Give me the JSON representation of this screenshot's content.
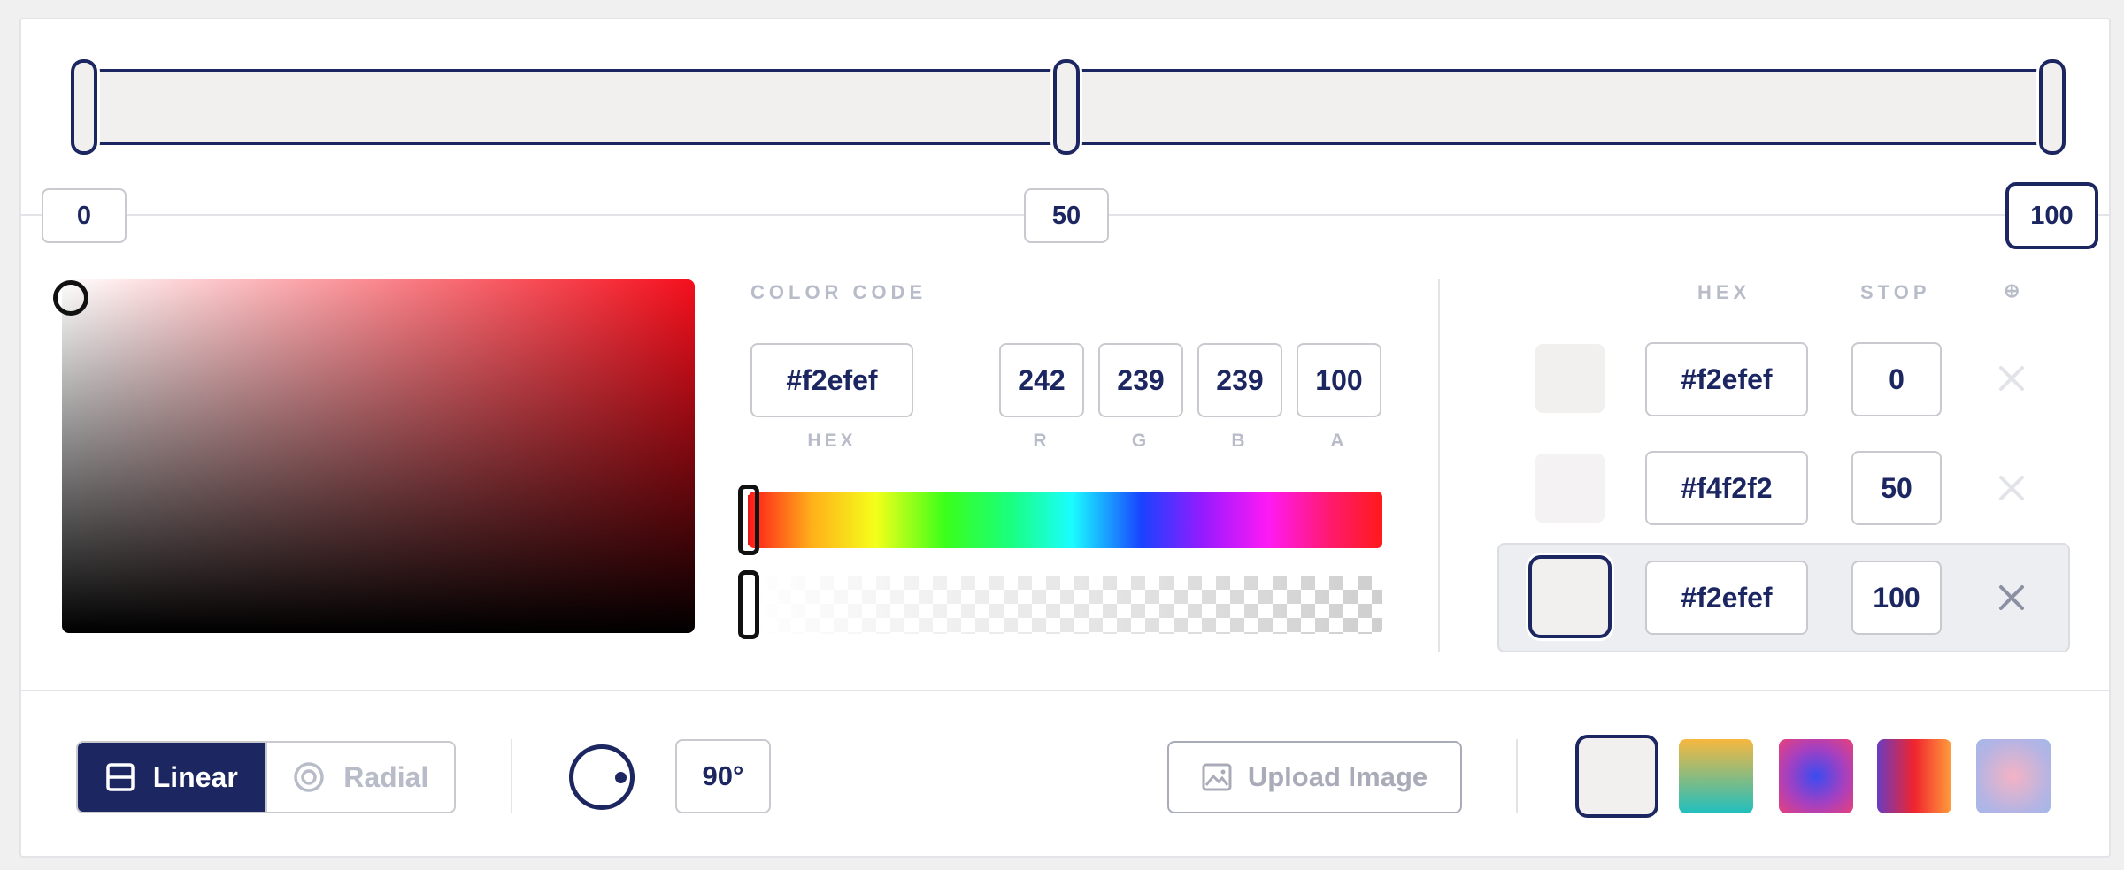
{
  "gradient_bar": {
    "stops": [
      {
        "label": "0"
      },
      {
        "label": "50"
      },
      {
        "label": "100"
      }
    ]
  },
  "picker": {
    "section_label": "COLOR CODE",
    "hex_value": "#f2efef",
    "hex_caption": "HEX",
    "r_value": "242",
    "r_caption": "R",
    "g_value": "239",
    "g_caption": "G",
    "b_value": "239",
    "b_caption": "B",
    "a_value": "100",
    "a_caption": "A"
  },
  "stops_table": {
    "hex_header": "HEX",
    "stop_header": "STOP",
    "add_glyph": "⊕",
    "rows": [
      {
        "color": "#f2efef",
        "hex": "#f2efef",
        "stop": "0"
      },
      {
        "color": "#f4f2f2",
        "hex": "#f4f2f2",
        "stop": "50"
      },
      {
        "color": "#f2efef",
        "hex": "#f2efef",
        "stop": "100"
      }
    ]
  },
  "footer": {
    "linear_label": "Linear",
    "radial_label": "Radial",
    "angle_value": "90°",
    "upload_label": "Upload Image",
    "presets": [
      {
        "icon": "preset-light-gray"
      },
      {
        "icon": "preset-yellow-teal"
      },
      {
        "icon": "preset-blue-pink-radial"
      },
      {
        "icon": "preset-purple-red-orange"
      },
      {
        "icon": "preset-pink-lavender-radial"
      }
    ]
  },
  "colors": {
    "accent": "#1c2660",
    "muted": "#b8bcc9",
    "border": "#c9c9cf"
  }
}
